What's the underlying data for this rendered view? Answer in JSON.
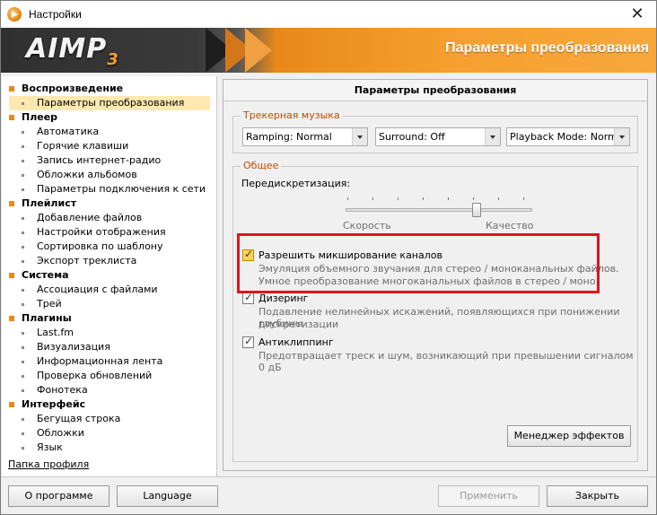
{
  "window": {
    "title": "Настройки",
    "close_glyph": "✕"
  },
  "banner": {
    "logo": "AIMP",
    "logo_sub": "3",
    "title": "Параметры преобразования"
  },
  "sidebar": {
    "categories": [
      {
        "label": "Воспроизведение",
        "items": [
          "Параметры преобразования"
        ]
      },
      {
        "label": "Плеер",
        "items": [
          "Автоматика",
          "Горячие клавиши",
          "Запись интернет-радио",
          "Обложки альбомов",
          "Параметры подключения к сети"
        ]
      },
      {
        "label": "Плейлист",
        "items": [
          "Добавление файлов",
          "Настройки отображения",
          "Сортировка по шаблону",
          "Экспорт треклиста"
        ]
      },
      {
        "label": "Система",
        "items": [
          "Ассоциация с файлами",
          "Трей"
        ]
      },
      {
        "label": "Плагины",
        "items": [
          "Last.fm",
          "Визуализация",
          "Информационная лента",
          "Проверка обновлений",
          "Фонотека"
        ]
      },
      {
        "label": "Интерфейс",
        "items": [
          "Бегущая строка",
          "Обложки",
          "Язык"
        ]
      }
    ],
    "selected": "Параметры преобразования",
    "profile_link": "Папка профиля"
  },
  "panel": {
    "header": "Параметры преобразования",
    "tracker": {
      "title": "Трекерная музыка",
      "ramping": "Ramping: Normal",
      "surround": "Surround: Off",
      "playback_mode": "Playback Mode: Normal"
    },
    "general": {
      "title": "Общее",
      "oversampling_label": "Передискретизация:",
      "slider_min_label": "Скорость",
      "slider_max_label": "Качество",
      "slider_level": 0.7,
      "channel_mixing": {
        "label": "Разрешить микширование каналов",
        "desc1": "Эмуляция объемного звучания для стерео / моноканальных файлов.",
        "desc2": "Умное преобразование многоканальных файлов в стерео / моно.",
        "checked": true
      },
      "dithering": {
        "label": "Дизеринг",
        "desc1": "Подавление нелинейных искажений, появляющихся при понижении глубины",
        "desc2": "дискретизации",
        "checked": true
      },
      "anticlipping": {
        "label": "Антиклиппинг",
        "desc1": "Предотвращает треск и шум, возникающий при превышении сигналом 0 дБ",
        "checked": true
      }
    },
    "effects_manager": "Менеджер эффектов"
  },
  "footer": {
    "about": "О программе",
    "language": "Language",
    "apply": "Применить",
    "close": "Закрыть"
  },
  "colors": {
    "accent": "#e8891a",
    "highlight_box": "#e0141e",
    "group_title": "#c24a00"
  }
}
